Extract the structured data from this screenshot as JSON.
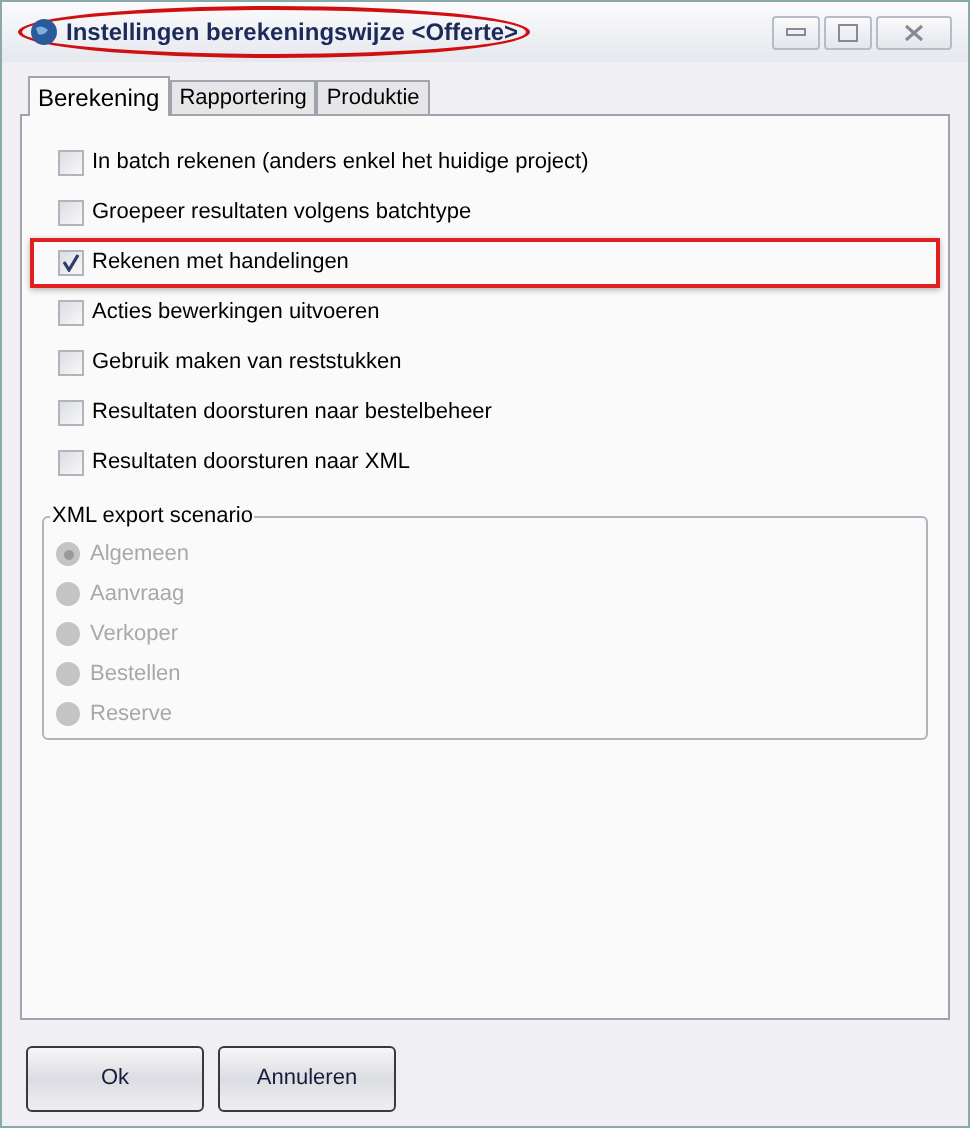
{
  "window": {
    "title": "Instellingen berekeningswijze <Offerte>",
    "title_highlighted": true
  },
  "tabs": [
    {
      "label": "Berekening",
      "selected": true
    },
    {
      "label": "Rapportering",
      "selected": false
    },
    {
      "label": "Produktie",
      "selected": false
    }
  ],
  "options": [
    {
      "label": "In batch rekenen (anders enkel het huidige project)",
      "checked": false,
      "highlighted": false
    },
    {
      "label": "Groepeer resultaten volgens batchtype",
      "checked": false,
      "highlighted": false
    },
    {
      "label": "Rekenen met handelingen",
      "checked": true,
      "highlighted": true
    },
    {
      "label": "Acties bewerkingen uitvoeren",
      "checked": false,
      "highlighted": false
    },
    {
      "label": "Gebruik maken van reststukken",
      "checked": false,
      "highlighted": false
    },
    {
      "label": "Resultaten doorsturen naar bestelbeheer",
      "checked": false,
      "highlighted": false
    },
    {
      "label": "Resultaten doorsturen naar XML",
      "checked": false,
      "highlighted": false
    }
  ],
  "xml_export": {
    "title": "XML export scenario",
    "disabled": true,
    "options": [
      {
        "label": "Algemeen",
        "selected": true
      },
      {
        "label": "Aanvraag",
        "selected": false
      },
      {
        "label": "Verkoper",
        "selected": false
      },
      {
        "label": "Bestellen",
        "selected": false
      },
      {
        "label": "Reserve",
        "selected": false
      }
    ]
  },
  "buttons": [
    "Ok",
    "Annuleren"
  ]
}
